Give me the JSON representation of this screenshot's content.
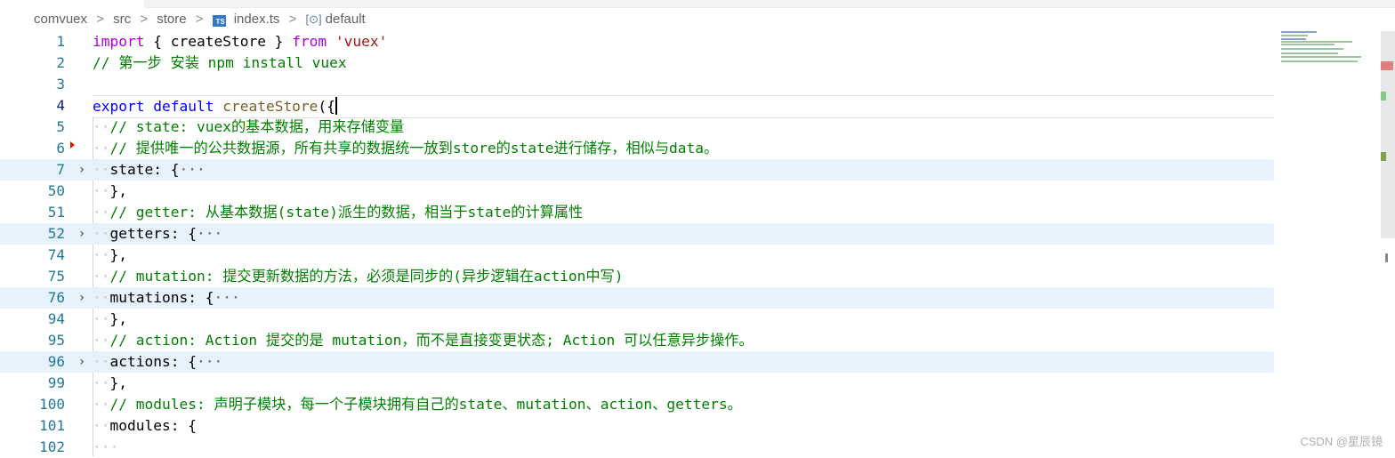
{
  "breadcrumb": {
    "items": [
      "comvuex",
      "src",
      "store"
    ],
    "file_badge": "TS",
    "file": "index.ts",
    "symbol": "default",
    "separator": ">"
  },
  "fold_ellipsis": "···",
  "lines": [
    {
      "num": "1",
      "code": "import { createStore } from 'vuex'"
    },
    {
      "num": "2",
      "code": "// 第一步 安装 npm install vuex"
    },
    {
      "num": "3",
      "code": ""
    },
    {
      "num": "4",
      "code": "export default createStore({",
      "active": true
    },
    {
      "num": "5",
      "code": "// state: vuex的基本数据，用来存储变量"
    },
    {
      "num": "6",
      "code": "// 提供唯一的公共数据源，所有共享的数据统一放到store的state进行储存，相似与data。"
    },
    {
      "num": "7",
      "code": "state: {",
      "folded": true
    },
    {
      "num": "50",
      "code": "},"
    },
    {
      "num": "51",
      "code": "// getter: 从基本数据(state)派生的数据，相当于state的计算属性"
    },
    {
      "num": "52",
      "code": "getters: {",
      "folded": true
    },
    {
      "num": "74",
      "code": "},"
    },
    {
      "num": "75",
      "code": "// mutation: 提交更新数据的方法，必须是同步的(异步逻辑在action中写)"
    },
    {
      "num": "76",
      "code": "mutations: {",
      "folded": true
    },
    {
      "num": "94",
      "code": "},"
    },
    {
      "num": "95",
      "code": "// action: Action 提交的是 mutation，而不是直接变更状态; Action 可以任意异步操作。"
    },
    {
      "num": "96",
      "code": "actions: {",
      "folded": true
    },
    {
      "num": "99",
      "code": "},"
    },
    {
      "num": "100",
      "code": "// modules: 声明子模块，每一个子模块拥有自己的state、mutation、action、getters。"
    },
    {
      "num": "101",
      "code": "modules: {"
    },
    {
      "num": "102",
      "code": ""
    }
  ],
  "tokens": {
    "import": "import",
    "open_brace": " { ",
    "createStore": "createStore",
    "close_brace": " } ",
    "from": "from",
    "vuex_str": "'vuex'",
    "export": "export",
    "default": "default",
    "paren": "({"
  },
  "watermark": "CSDN @星辰镜",
  "colors": {
    "keyword": "#0000ff",
    "control": "#af00db",
    "string": "#a31515",
    "comment": "#008000",
    "line_number": "#237893",
    "fold_highlight": "#e6f1fc"
  }
}
